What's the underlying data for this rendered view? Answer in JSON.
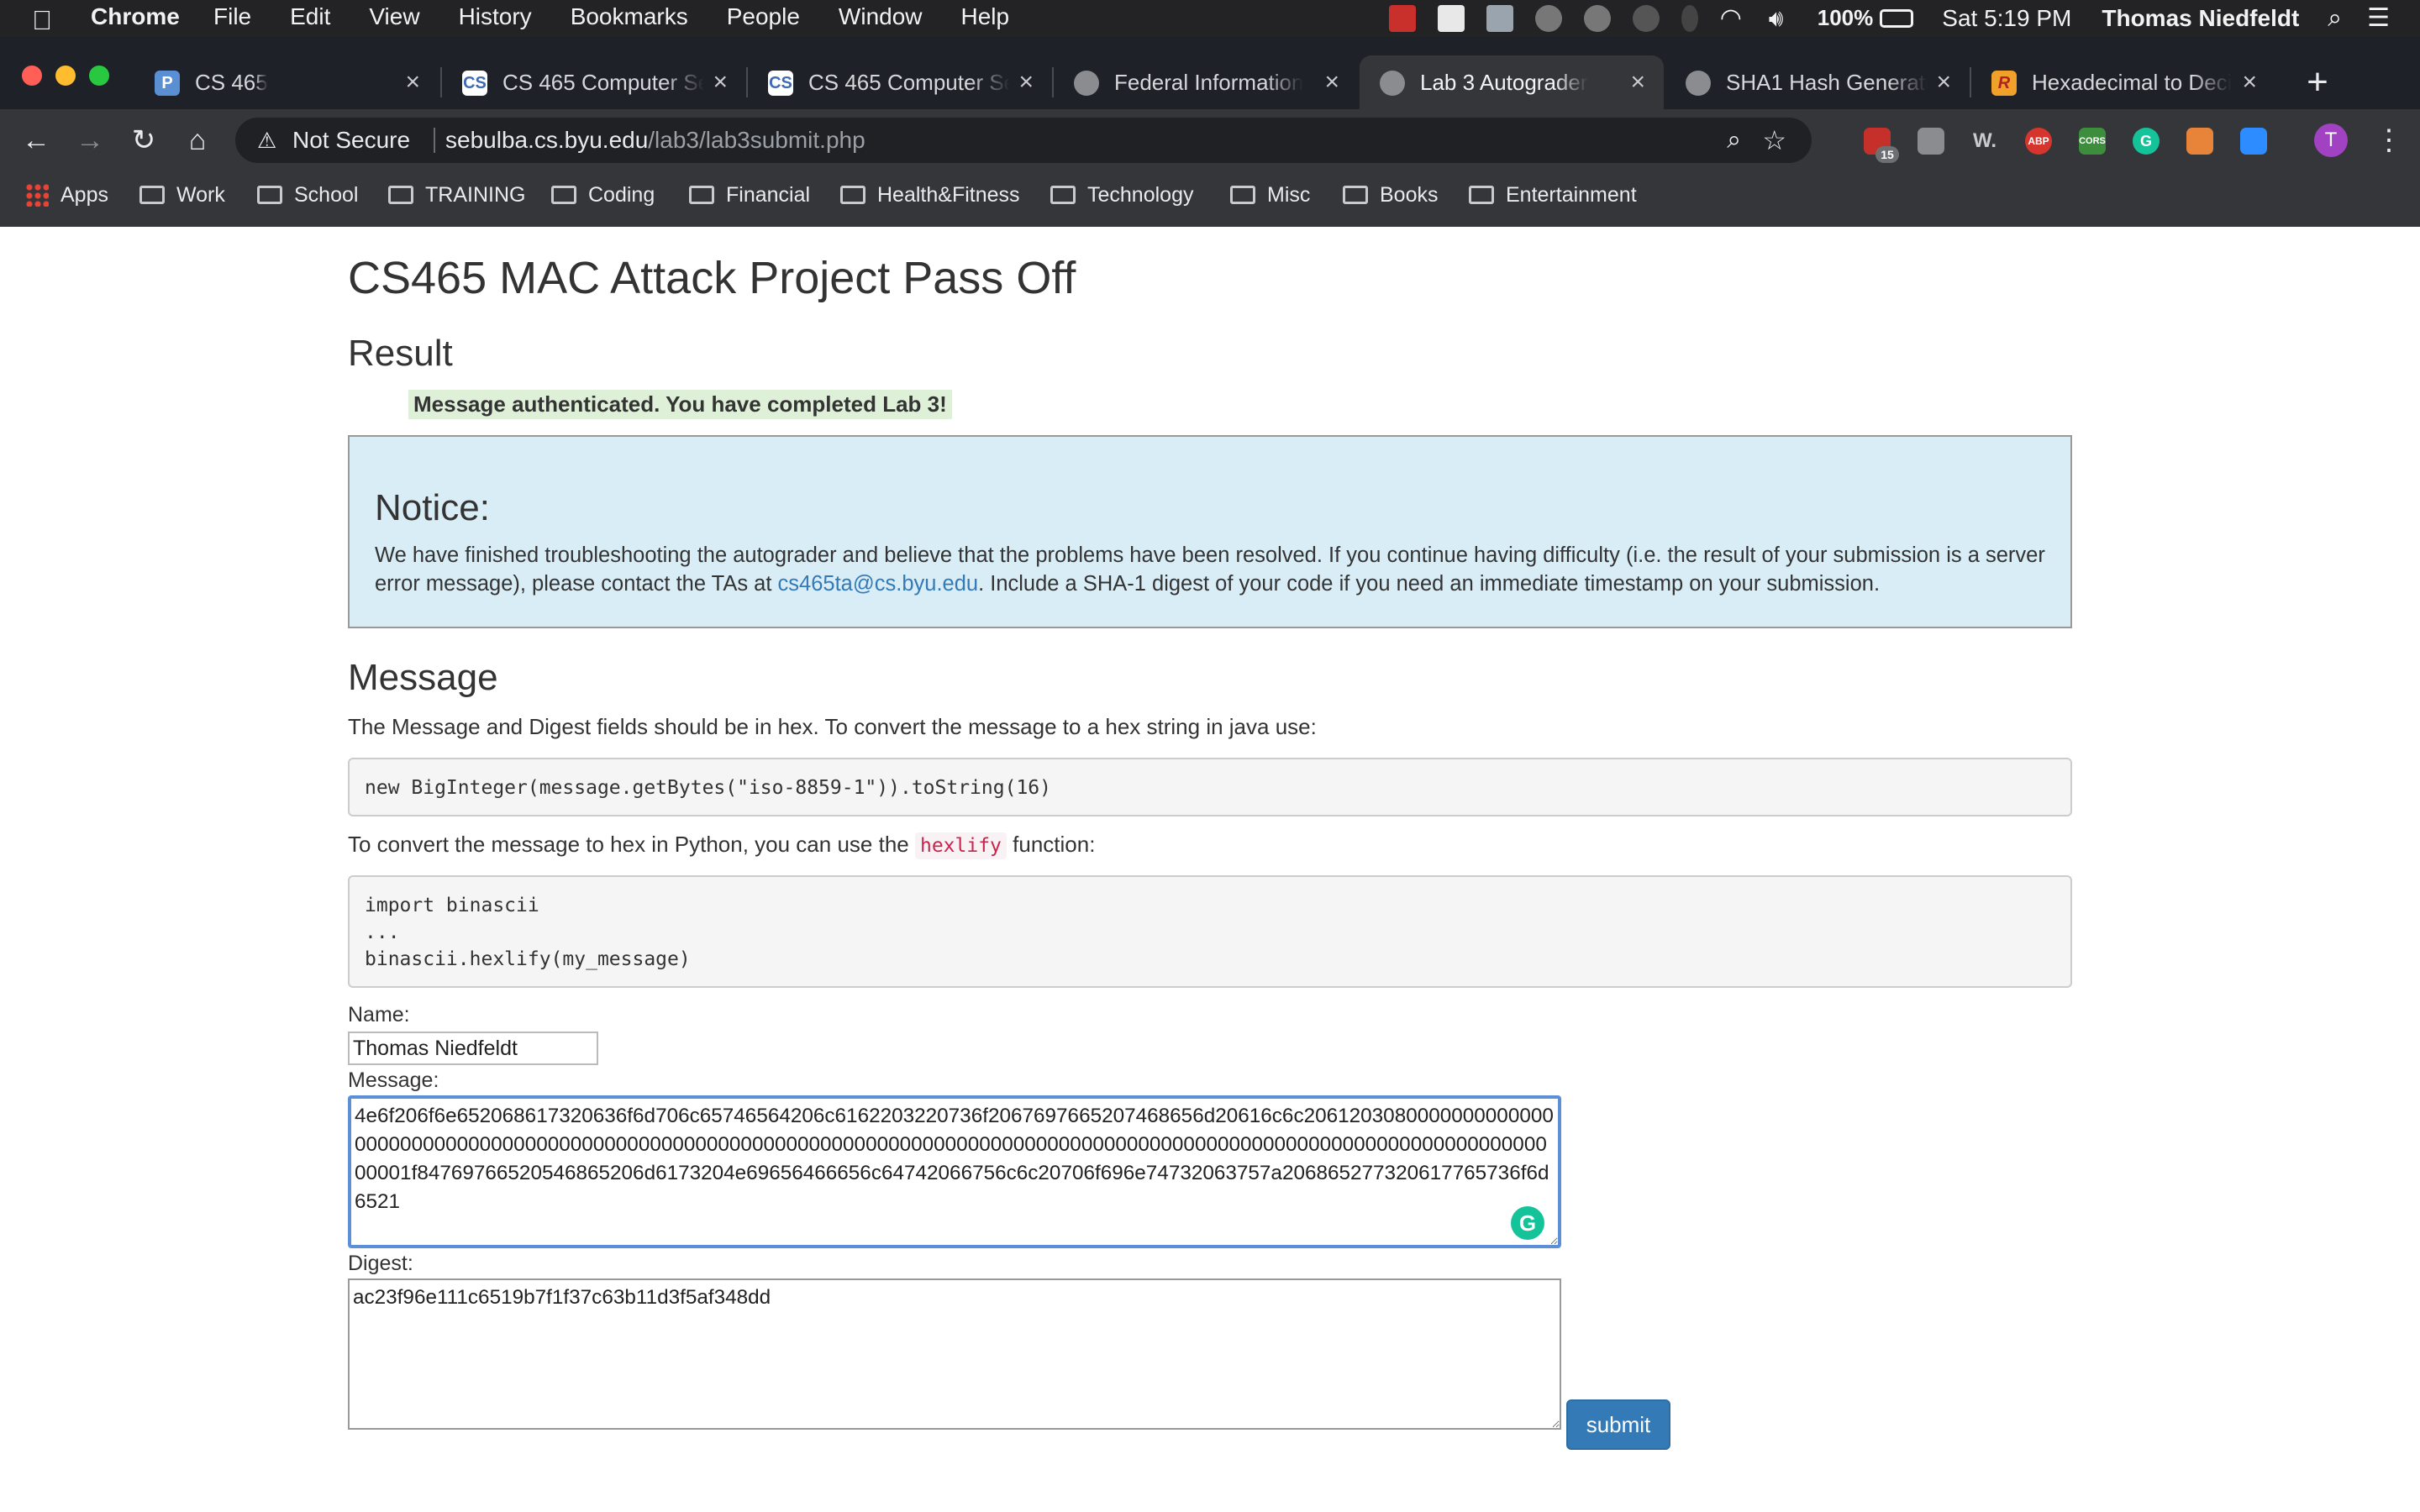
{
  "macos": {
    "app_name": "Chrome",
    "menus": [
      "File",
      "Edit",
      "View",
      "History",
      "Bookmarks",
      "People",
      "Window",
      "Help"
    ],
    "battery": "100%",
    "clock": "Sat 5:19 PM",
    "user": "Thomas Niedfeldt"
  },
  "browser": {
    "tabs": [
      {
        "title": "CS 465",
        "favicon": "P",
        "active": false
      },
      {
        "title": "CS 465 Computer Se",
        "favicon": "CS",
        "active": false
      },
      {
        "title": "CS 465 Computer Se",
        "favicon": "CS",
        "active": false
      },
      {
        "title": "Federal Information",
        "favicon": "globe",
        "active": false
      },
      {
        "title": "Lab 3 Autograder",
        "favicon": "globe",
        "active": true
      },
      {
        "title": "SHA1 Hash Generato",
        "favicon": "globe",
        "active": false
      },
      {
        "title": "Hexadecimal to Deci",
        "favicon": "R",
        "active": false
      }
    ],
    "security_label": "Not Secure",
    "url_host": "sebulba.cs.byu.edu",
    "url_path": "/lab3/lab3submit.php",
    "extension_badge": "15",
    "extensions": [
      {
        "name": "calendar-extension-icon",
        "label": "",
        "color": "#c5302b"
      },
      {
        "name": "notes-extension-icon",
        "label": "",
        "color": "#8a8c90"
      },
      {
        "name": "wikipedia-extension-icon",
        "label": "W.",
        "color": "transparent"
      },
      {
        "name": "adblock-plus-icon",
        "label": "ABP",
        "color": "#d6352d"
      },
      {
        "name": "cors-extension-icon",
        "label": "CORS",
        "color": "#3c8e3c"
      },
      {
        "name": "grammarly-extension-icon",
        "label": "G",
        "color": "#15c39a"
      },
      {
        "name": "megaphone-extension-icon",
        "label": "",
        "color": "#e8833a"
      },
      {
        "name": "zoom-extension-icon",
        "label": "",
        "color": "#2d8cff"
      }
    ],
    "profile_initial": "T",
    "bookmarks": [
      "Apps",
      "Work",
      "School",
      "TRAINING",
      "Coding",
      "Financial",
      "Health&Fitness",
      "Technology",
      "Misc",
      "Books",
      "Entertainment"
    ]
  },
  "page": {
    "title": "CS465 MAC Attack Project Pass Off",
    "result_heading": "Result",
    "result_message": "Message authenticated. You have completed Lab 3!",
    "notice": {
      "heading": "Notice:",
      "text_before": "We have finished troubleshooting the autograder and believe that the problems have been resolved. If you continue having difficulty (i.e. the result of your submission is a server error message), please contact the TAs at ",
      "email": "cs465ta@cs.byu.edu",
      "text_after": ". Include a SHA-1 digest of your code if you need an immediate timestamp on your submission."
    },
    "message_heading": "Message",
    "java_intro": "The Message and Digest fields should be in hex. To convert the message to a hex string in java use:",
    "java_code": "new BigInteger(message.getBytes(\"iso-8859-1\")).toString(16)",
    "python_intro_before": "To convert the message to hex in Python, you can use the ",
    "python_intro_code": "hexlify",
    "python_intro_after": " function:",
    "python_code": "import binascii\n...\nbinascii.hexlify(my_message)",
    "form": {
      "name_label": "Name:",
      "name_value": "Thomas Niedfeldt",
      "message_label": "Message:",
      "message_value": "4e6f206f6e652068617320636f6d706c65746564206c6162203220736f2067697665207468656d20616c6c206120308000000000000000000000000000000000000000000000000000000000000000000000000000000000000000000000000000000000000000000000000001f84769766520546865206d6173204e69656466656c64742066756c6c20706f696e74732063757a206865277320617765736f6d6521",
      "digest_label": "Digest:",
      "digest_value": "ac23f96e111c6519b7f1f37c63b11d3f5af348dd",
      "submit_label": "submit"
    }
  }
}
